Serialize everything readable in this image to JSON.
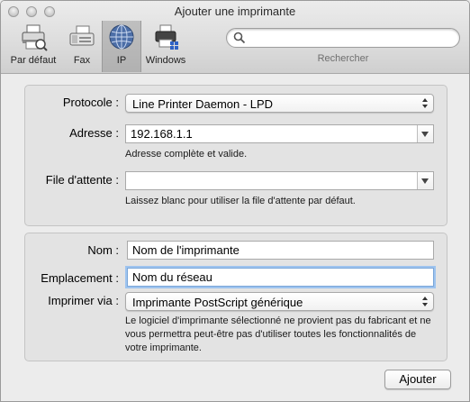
{
  "window": {
    "title": "Ajouter une imprimante"
  },
  "toolbar": {
    "items": [
      {
        "label": "Par défaut",
        "icon": "default-printer-icon"
      },
      {
        "label": "Fax",
        "icon": "fax-icon"
      },
      {
        "label": "IP",
        "icon": "globe-icon",
        "selected": true
      },
      {
        "label": "Windows",
        "icon": "windows-printer-icon"
      }
    ],
    "search": {
      "value": "",
      "label": "Rechercher",
      "icon": "search-icon"
    }
  },
  "connection": {
    "protocol_label": "Protocole :",
    "protocol_value": "Line Printer Daemon - LPD",
    "address_label": "Adresse :",
    "address_value": "192.168.1.1",
    "address_hint": "Adresse complète et valide.",
    "queue_label": "File d'attente :",
    "queue_value": "",
    "queue_hint": "Laissez blanc pour utiliser la file d'attente par défaut."
  },
  "printer": {
    "name_label": "Nom :",
    "name_value": "Nom de l'imprimante",
    "location_label": "Emplacement :",
    "location_value": "Nom du réseau",
    "driver_label": "Imprimer via :",
    "driver_value": "Imprimante PostScript générique",
    "driver_hint": "Le logiciel d'imprimante sélectionné ne provient pas du fabricant et ne vous permettra peut-être pas d'utiliser toutes les fonctionnalités de votre imprimante."
  },
  "actions": {
    "add_label": "Ajouter"
  }
}
